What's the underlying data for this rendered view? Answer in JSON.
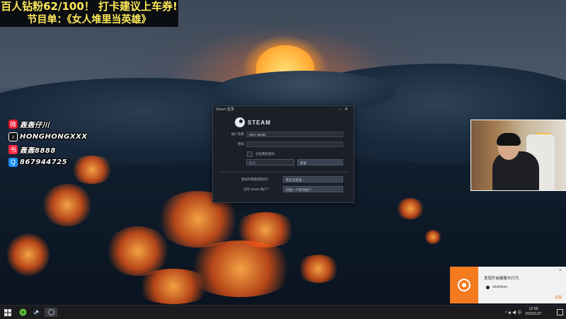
{
  "overlay": {
    "banner_line1": "百人钻粉62/100！ 打卡建议上车券!",
    "banner_line2": "节目单：《女人堆里当英雄》",
    "socials": [
      {
        "icon": "weibo-icon",
        "text": "轰轰仔川",
        "color": "#e6162d"
      },
      {
        "icon": "tiktok-icon",
        "text": "HONGHONGXXX",
        "color": "#111111"
      },
      {
        "icon": "xiaohongshu-icon",
        "text": "轰轰8888",
        "color": "#ff2442"
      },
      {
        "icon": "qq-icon",
        "text": "867944725",
        "color": "#1e90ff"
      }
    ]
  },
  "steam_dialog": {
    "window_title": "Steam 登录",
    "logo_text": "STEAM",
    "account_label": "帐户名称",
    "account_value": "2547 49460",
    "password_label": "密码",
    "password_value": "",
    "remember_label": "记住我的密码",
    "cancel_label": "取消",
    "login_label": "登录",
    "help_question": "登录时需要帮助吗？",
    "help_button": "我无法登录...",
    "noaccount_question": "没有 Steam 帐户？",
    "create_button": "创建一个新的帐户..."
  },
  "notification": {
    "title": "发现开启摄像头行为",
    "user": "xhsh4xxx",
    "action": "设置",
    "accent": "#f47b20"
  },
  "taskbar": {
    "time": "12:00",
    "date": "2022/1/27",
    "tray": "^ ■ ◀ 中"
  }
}
